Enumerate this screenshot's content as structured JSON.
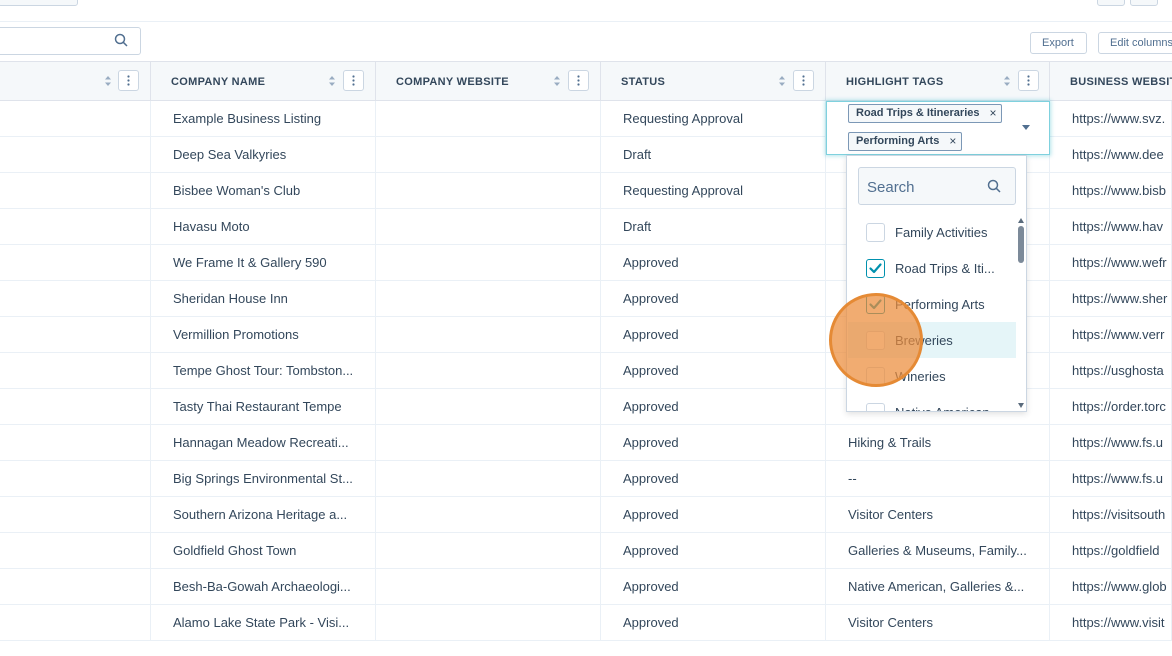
{
  "toolbar": {
    "search_icon": "search-icon",
    "export_label": "Export",
    "edit_columns_label": "Edit columns"
  },
  "columns": {
    "company_name": "COMPANY NAME",
    "company_website": "COMPANY WEBSITE",
    "status": "STATUS",
    "highlight_tags": "HIGHLIGHT TAGS",
    "business_website": "BUSINESS WEBSIT"
  },
  "rows": [
    {
      "company": "Example Business Listing",
      "status": "Requesting Approval",
      "tags": "",
      "site": "https://www.svz."
    },
    {
      "company": "Deep Sea Valkyries",
      "status": "Draft",
      "tags": "",
      "site": "https://www.dee"
    },
    {
      "company": "Bisbee Woman's Club",
      "status": "Requesting Approval",
      "tags": "",
      "site": "https://www.bisb"
    },
    {
      "company": "Havasu Moto",
      "status": "Draft",
      "tags": "",
      "site": "https://www.hav"
    },
    {
      "company": "We Frame It & Gallery 590",
      "status": "Approved",
      "tags": "",
      "site": "https://www.wefr"
    },
    {
      "company": "Sheridan House Inn",
      "status": "Approved",
      "tags": "",
      "site": "https://www.sher"
    },
    {
      "company": "Vermillion Promotions",
      "status": "Approved",
      "tags": "",
      "site": "https://www.verr"
    },
    {
      "company": "Tempe Ghost Tour: Tombston...",
      "status": "Approved",
      "tags": "",
      "site": "https://usghosta"
    },
    {
      "company": "Tasty Thai Restaurant Tempe",
      "status": "Approved",
      "tags": "",
      "site": "https://order.torc"
    },
    {
      "company": "Hannagan Meadow Recreati...",
      "status": "Approved",
      "tags": "Hiking & Trails",
      "site": "https://www.fs.u"
    },
    {
      "company": "Big Springs Environmental St...",
      "status": "Approved",
      "tags": "--",
      "site": "https://www.fs.u"
    },
    {
      "company": "Southern Arizona Heritage a...",
      "status": "Approved",
      "tags": "Visitor Centers",
      "site": "https://visitsouth"
    },
    {
      "company": "Goldfield Ghost Town",
      "status": "Approved",
      "tags": "Galleries & Museums, Family...",
      "site": "https://goldfield"
    },
    {
      "company": "Besh-Ba-Gowah Archaeologi...",
      "status": "Approved",
      "tags": "Native American, Galleries &...",
      "site": "https://www.glob"
    },
    {
      "company": "Alamo Lake State Park - Visi...",
      "status": "Approved",
      "tags": "Visitor Centers",
      "site": "https://www.visit"
    }
  ],
  "tag_editor": {
    "chips": [
      "Road Trips & Itineraries",
      "Performing Arts"
    ],
    "remove_glyph": "×"
  },
  "dropdown": {
    "search_placeholder": "Search",
    "options": [
      {
        "label": "Family Activities",
        "checked": false
      },
      {
        "label": "Road Trips & Iti...",
        "checked": true
      },
      {
        "label": "Performing Arts",
        "checked": true
      },
      {
        "label": "Breweries",
        "checked": false
      },
      {
        "label": "Wineries",
        "checked": false
      },
      {
        "label": "Native American",
        "checked": false
      }
    ]
  },
  "colors": {
    "accent": "#0091ae",
    "cursor_highlight": "#e58a35",
    "header_bg": "#f5f8fa",
    "text": "#33475b"
  }
}
